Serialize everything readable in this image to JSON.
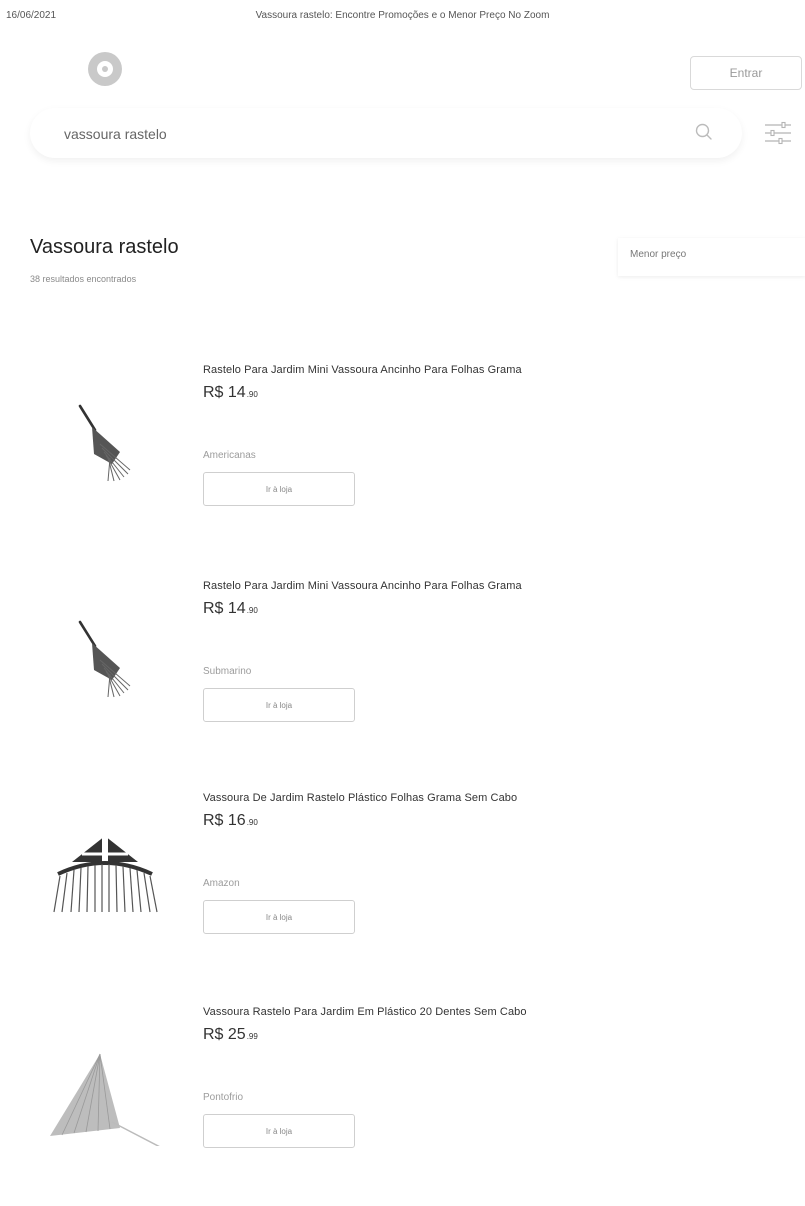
{
  "print_header": {
    "date": "16/06/2021",
    "title": "Vassoura rastelo: Encontre Promoções e o Menor Preço No Zoom"
  },
  "header": {
    "login_label": "Entrar"
  },
  "search": {
    "value": "vassoura rastelo"
  },
  "results": {
    "title": "Vassoura rastelo",
    "count_text": "38 resultados encontrados",
    "sort_label": "Menor preço"
  },
  "products": [
    {
      "title": "Rastelo Para Jardim Mini Vassoura Ancinho Para Folhas Grama",
      "price_main": "R$ 14",
      "price_cents": ".90",
      "store": "Americanas",
      "button_label": "Ir à loja",
      "image_icon": "small-hand-rake"
    },
    {
      "title": "Rastelo Para Jardim Mini Vassoura Ancinho Para Folhas Grama",
      "price_main": "R$ 14",
      "price_cents": ".90",
      "store": "Submarino",
      "button_label": "Ir à loja",
      "image_icon": "small-hand-rake"
    },
    {
      "title": "Vassoura De Jardim Rastelo Plástico Folhas Grama Sem Cabo",
      "price_main": "R$ 16",
      "price_cents": ".90",
      "store": "Amazon",
      "button_label": "Ir à loja",
      "image_icon": "fan-rake-head"
    },
    {
      "title": "Vassoura Rastelo Para Jardim Em Plástico 20 Dentes Sem Cabo",
      "price_main": "R$ 25",
      "price_cents": ".99",
      "store": "Pontofrio",
      "button_label": "Ir à loja",
      "image_icon": "triangle-rake"
    }
  ]
}
